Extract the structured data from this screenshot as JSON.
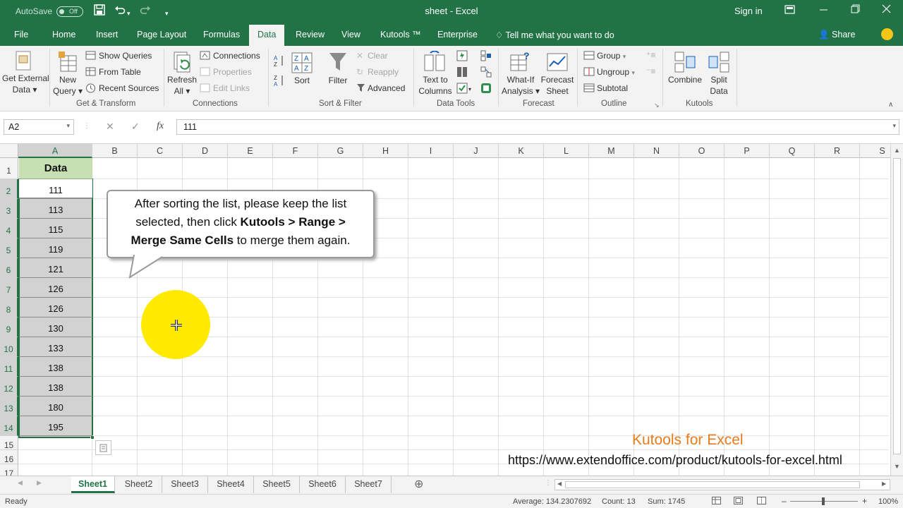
{
  "titlebar": {
    "autosave_label": "AutoSave",
    "autosave_state": "Off",
    "title": "sheet - Excel",
    "signin": "Sign in"
  },
  "tabs": [
    "File",
    "Home",
    "Insert",
    "Page Layout",
    "Formulas",
    "Data",
    "Review",
    "View",
    "Kutools ™",
    "Enterprise"
  ],
  "active_tab": "Data",
  "tellme": "Tell me what you want to do",
  "share": "Share",
  "ribbon": {
    "get_external_data": [
      "Get External",
      "Data"
    ],
    "new_query": [
      "New",
      "Query"
    ],
    "show_queries": "Show Queries",
    "from_table": "From Table",
    "recent_sources": "Recent Sources",
    "refresh_all": [
      "Refresh",
      "All"
    ],
    "connections": "Connections",
    "properties": "Properties",
    "edit_links": "Edit Links",
    "sort_az": "A Z",
    "sort": "Sort",
    "filter": "Filter",
    "clear": "Clear",
    "reapply": "Reapply",
    "advanced": "Advanced",
    "text_to_columns": [
      "Text to",
      "Columns"
    ],
    "what_if": [
      "What-If",
      "Analysis"
    ],
    "forecast_sheet": [
      "Forecast",
      "Sheet"
    ],
    "group": "Group",
    "ungroup": "Ungroup",
    "subtotal": "Subtotal",
    "combine": "Combine",
    "split_data": [
      "Split",
      "Data"
    ],
    "group_labels": {
      "get_transform": "Get & Transform",
      "connections": "Connections",
      "sort_filter": "Sort & Filter",
      "data_tools": "Data Tools",
      "forecast": "Forecast",
      "outline": "Outline",
      "kutools": "Kutools"
    }
  },
  "formula_bar": {
    "name_box": "A2",
    "fx": "fx",
    "value": "111"
  },
  "columns": [
    "A",
    "B",
    "C",
    "D",
    "E",
    "F",
    "G",
    "H",
    "I",
    "J",
    "K",
    "L",
    "M",
    "N",
    "O",
    "P",
    "Q",
    "R",
    "S"
  ],
  "rows": [
    "1",
    "2",
    "3",
    "4",
    "5",
    "6",
    "7",
    "8",
    "9",
    "10",
    "11",
    "12",
    "13",
    "14",
    "15",
    "16",
    "17"
  ],
  "header_cell": "Data",
  "data_values": [
    "111",
    "113",
    "115",
    "119",
    "121",
    "126",
    "126",
    "130",
    "133",
    "138",
    "138",
    "180",
    "195"
  ],
  "callout": {
    "line1": "After sorting the list, please keep the list",
    "line2a": "selected, then click ",
    "line2b": "Kutools > Range >",
    "line3a": "Merge Same Cells",
    "line3b": " to merge them again."
  },
  "watermark": {
    "brand": "Kutools for Excel",
    "url": "https://www.extendoffice.com/product/kutools-for-excel.html"
  },
  "sheet_tabs": [
    "Sheet1",
    "Sheet2",
    "Sheet3",
    "Sheet4",
    "Sheet5",
    "Sheet6",
    "Sheet7"
  ],
  "active_sheet": "Sheet1",
  "status": {
    "ready": "Ready",
    "average": "Average: 134.2307692",
    "count": "Count: 13",
    "sum": "Sum: 1745",
    "zoom": "100%"
  },
  "colors": {
    "excel_green": "#217346",
    "highlight": "#ffea00",
    "brand_orange": "#e87b1c"
  }
}
